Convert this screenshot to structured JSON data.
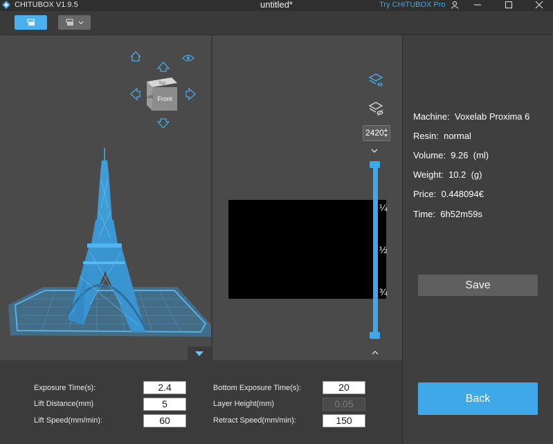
{
  "app": {
    "name": "CHITUBOX V1.9.5",
    "document_title": "untitled*",
    "pro_link": "Try CHITUBOX Pro"
  },
  "view_cube": {
    "face_label": "Front",
    "top_label": "Top",
    "side_label": "Left"
  },
  "layer_preview": {
    "current_layer": "2420",
    "slider_marks": [
      "¼",
      "½",
      "¾"
    ]
  },
  "print_info": {
    "machine_label": "Machine:",
    "machine_value": "Voxelab Proxima 6",
    "resin_label": "Resin:",
    "resin_value": "normal",
    "volume_label": "Volume:",
    "volume_value": "9.26  (ml)",
    "weight_label": "Weight:",
    "weight_value": "10.2  (g)",
    "price_label": "Price:",
    "price_value": "0.448094€",
    "time_label": "Time:",
    "time_value": "6h52m59s",
    "save_label": "Save",
    "back_label": "Back"
  },
  "params": {
    "exposure_time_label": "Exposure Time(s):",
    "exposure_time_value": "2.4",
    "lift_distance_label": "Lift Distance(mm)",
    "lift_distance_value": "5",
    "lift_speed_label": "Lift Speed(mm/min):",
    "lift_speed_value": "60",
    "bottom_exposure_label": "Bottom Exposure Time(s):",
    "bottom_exposure_value": "20",
    "layer_height_label": "Layer Height(mm)",
    "layer_height_value": "0.05",
    "retract_speed_label": "Retract Speed(mm/min):",
    "retract_speed_value": "150"
  },
  "colors": {
    "accent": "#3ea8e8",
    "panel_bg": "#4a4a4a",
    "model_blue": "#44a8e0"
  }
}
